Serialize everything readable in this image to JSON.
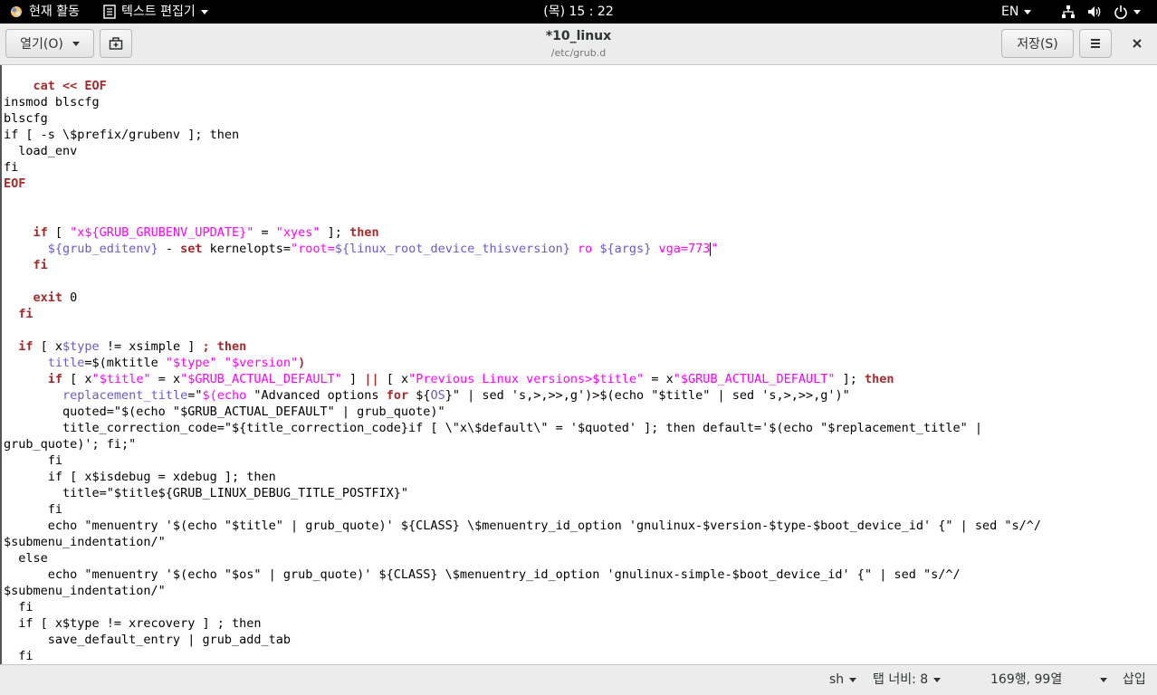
{
  "topbar": {
    "activities": "현재 활동",
    "app_name": "텍스트 편집기",
    "clock": "(목) 15 : 22",
    "lang": "EN"
  },
  "header": {
    "open_label": "열기(O)",
    "title": "*10_linux",
    "subtitle": "/etc/grub.d",
    "save_label": "저장(S)"
  },
  "editor": {
    "lines": [
      [
        {
          "t": "    "
        },
        {
          "t": "cat << EOF",
          "c": "k"
        }
      ],
      [
        {
          "t": "insmod blscfg"
        }
      ],
      [
        {
          "t": "blscfg"
        }
      ],
      [
        {
          "t": "if [ -s \\$prefix/grubenv ]; then"
        }
      ],
      [
        {
          "t": "  load_env"
        }
      ],
      [
        {
          "t": "fi"
        }
      ],
      [
        {
          "t": "EOF",
          "c": "k"
        }
      ],
      [
        {
          "t": ""
        }
      ],
      [
        {
          "t": ""
        }
      ],
      [
        {
          "t": "    "
        },
        {
          "t": "if",
          "c": "k"
        },
        {
          "t": " [ "
        },
        {
          "t": "\"x${GRUB_GRUBENV_UPDATE}\"",
          "c": "s"
        },
        {
          "t": " = "
        },
        {
          "t": "\"xyes\"",
          "c": "s"
        },
        {
          "t": " ]; "
        },
        {
          "t": "then",
          "c": "k"
        }
      ],
      [
        {
          "t": "      "
        },
        {
          "t": "${grub_editenv}",
          "c": "v"
        },
        {
          "t": " - "
        },
        {
          "t": "set",
          "c": "k"
        },
        {
          "t": " kernelopts="
        },
        {
          "t": "\"root=",
          "c": "s"
        },
        {
          "t": "${linux_root_device_thisversion}",
          "c": "v"
        },
        {
          "t": " ro ",
          "c": "s"
        },
        {
          "t": "${args}",
          "c": "v"
        },
        {
          "t": " vga=773",
          "c": "s"
        },
        {
          "t": "",
          "cursor": true
        },
        {
          "t": "\"",
          "c": "s"
        }
      ],
      [
        {
          "t": "    "
        },
        {
          "t": "fi",
          "c": "k"
        }
      ],
      [
        {
          "t": ""
        }
      ],
      [
        {
          "t": "    "
        },
        {
          "t": "exit",
          "c": "k"
        },
        {
          "t": " 0"
        }
      ],
      [
        {
          "t": "  "
        },
        {
          "t": "fi",
          "c": "k"
        }
      ],
      [
        {
          "t": ""
        }
      ],
      [
        {
          "t": "  "
        },
        {
          "t": "if",
          "c": "k"
        },
        {
          "t": " [ x"
        },
        {
          "t": "$type",
          "c": "v"
        },
        {
          "t": " != xsimple ] "
        },
        {
          "t": "; then",
          "c": "k"
        }
      ],
      [
        {
          "t": "      "
        },
        {
          "t": "title",
          "c": "v"
        },
        {
          "t": "=$(mktitle "
        },
        {
          "t": "\"$type\"",
          "c": "s"
        },
        {
          "t": " "
        },
        {
          "t": "\"$version\"",
          "c": "s"
        },
        {
          "t": ")",
          "c": "k"
        }
      ],
      [
        {
          "t": "      "
        },
        {
          "t": "if",
          "c": "k"
        },
        {
          "t": " [ x"
        },
        {
          "t": "\"$title\"",
          "c": "s"
        },
        {
          "t": " = x"
        },
        {
          "t": "\"$GRUB_ACTUAL_DEFAULT\"",
          "c": "s"
        },
        {
          "t": " ] "
        },
        {
          "t": "||",
          "c": "k"
        },
        {
          "t": " [ x"
        },
        {
          "t": "\"Previous Linux versions>$title\"",
          "c": "s"
        },
        {
          "t": " = x"
        },
        {
          "t": "\"$GRUB_ACTUAL_DEFAULT\"",
          "c": "s"
        },
        {
          "t": " ]; "
        },
        {
          "t": "then",
          "c": "k"
        }
      ],
      [
        {
          "t": "        "
        },
        {
          "t": "replacement_title",
          "c": "v"
        },
        {
          "t": "=\""
        },
        {
          "t": "$(echo ",
          "c": "s"
        },
        {
          "t": "\"Advanced options "
        },
        {
          "t": "for",
          "c": "k"
        },
        {
          "t": " ${"
        },
        {
          "t": "OS",
          "c": "v"
        },
        {
          "t": "}\" | sed 's,>,>>,g')>$(echo \"$title\" | sed 's,>,>>,g')\""
        }
      ],
      [
        {
          "t": "        quoted=\"$(echo \"$GRUB_ACTUAL_DEFAULT\" | grub_quote)\""
        }
      ],
      [
        {
          "t": "        title_correction_code=\"${title_correction_code}if [ \\\"x\\$default\\\" = '$quoted' ]; then default='$(echo \"$replacement_title\" |"
        }
      ],
      [
        {
          "t": "grub_quote)'; fi;\""
        }
      ],
      [
        {
          "t": "      fi"
        }
      ],
      [
        {
          "t": "      if [ x$isdebug = xdebug ]; then"
        }
      ],
      [
        {
          "t": "        title=\"$title${GRUB_LINUX_DEBUG_TITLE_POSTFIX}\""
        }
      ],
      [
        {
          "t": "      fi"
        }
      ],
      [
        {
          "t": "      echo \"menuentry '$(echo \"$title\" | grub_quote)' ${CLASS} \\$menuentry_id_option 'gnulinux-$version-$type-$boot_device_id' {\" | sed \"s/^/"
        }
      ],
      [
        {
          "t": "$submenu_indentation/\""
        }
      ],
      [
        {
          "t": "  else"
        }
      ],
      [
        {
          "t": "      echo \"menuentry '$(echo \"$os\" | grub_quote)' ${CLASS} \\$menuentry_id_option 'gnulinux-simple-$boot_device_id' {\" | sed \"s/^/"
        }
      ],
      [
        {
          "t": "$submenu_indentation/\""
        }
      ],
      [
        {
          "t": "  fi"
        }
      ],
      [
        {
          "t": "  if [ x$type != xrecovery ] ; then"
        }
      ],
      [
        {
          "t": "      save_default_entry | grub_add_tab"
        }
      ],
      [
        {
          "t": "  fi"
        }
      ]
    ]
  },
  "statusbar": {
    "language": "sh",
    "tab_width": "탭 너비: 8",
    "position": "169행, 99열",
    "mode": "삽입"
  }
}
